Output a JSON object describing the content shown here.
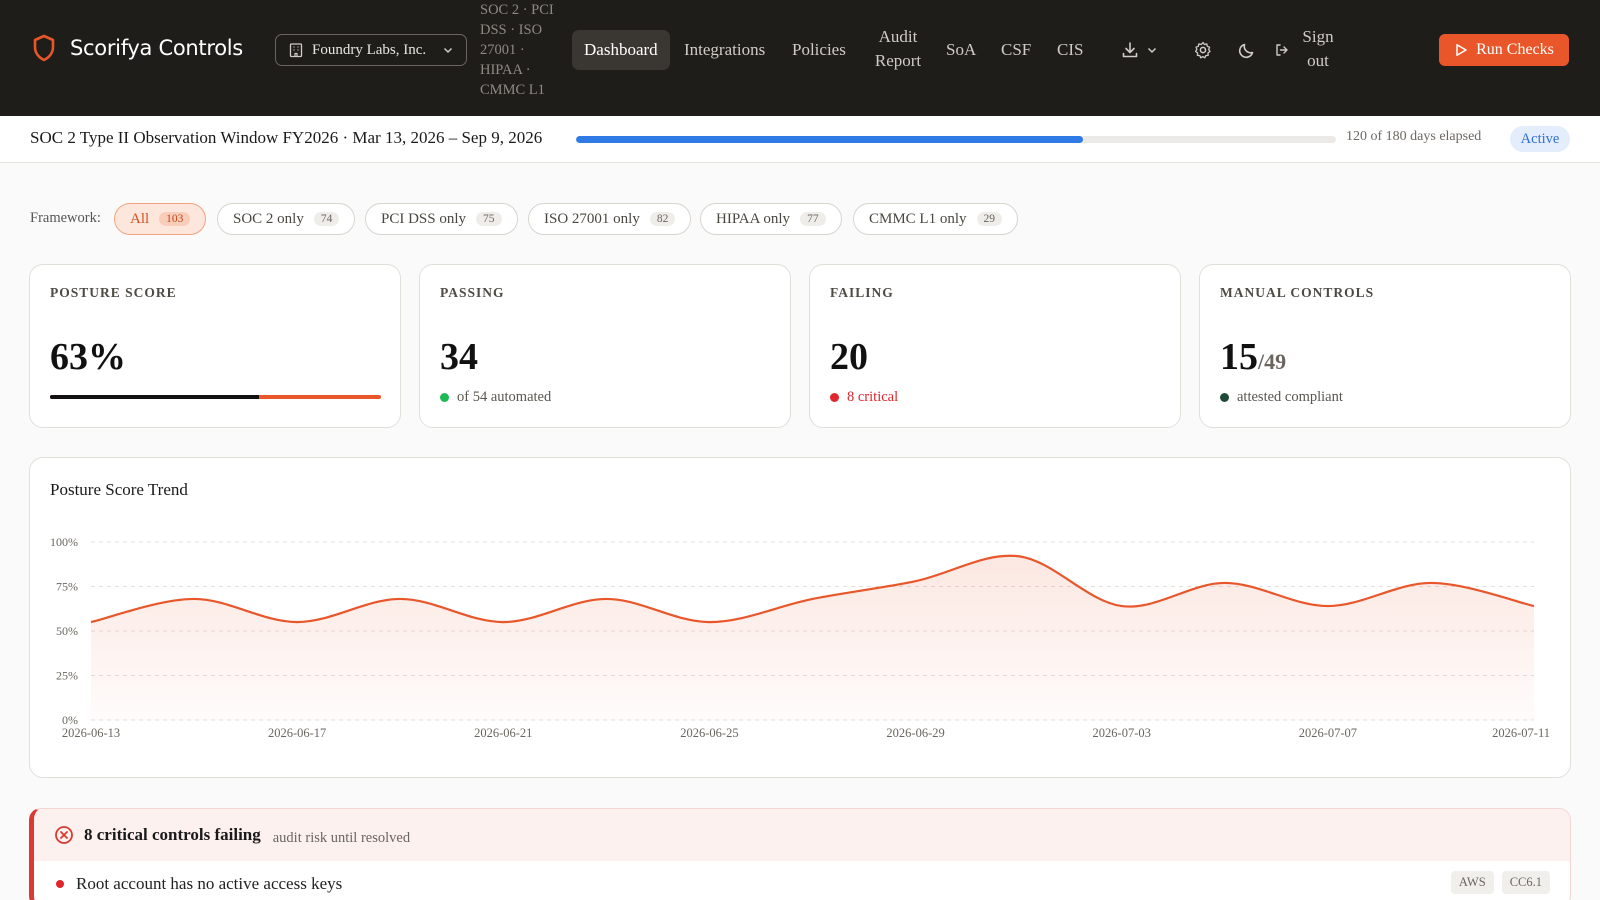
{
  "app": {
    "brand_name": "Scorifya Controls",
    "org_name": "Foundry Labs, Inc.",
    "frameworks_line": "SOC 2 · PCI DSS · ISO 27001 · HIPAA · CMMC L1"
  },
  "nav": {
    "items": [
      {
        "label": "Dashboard",
        "active": true
      },
      {
        "label": "Integrations"
      },
      {
        "label": "Policies"
      },
      {
        "label": "Audit Report"
      },
      {
        "label": "SoA"
      },
      {
        "label": "CSF"
      },
      {
        "label": "CIS"
      }
    ],
    "sign_out": "Sign out",
    "run_checks": "Run Checks",
    "icons": [
      "download-icon",
      "chevron-down-icon",
      "gear-icon",
      "moon-icon",
      "sign-out-icon",
      "play-icon"
    ]
  },
  "observation": {
    "title": "SOC 2 Type II Observation Window FY2026 · Mar 13, 2026 – Sep 9, 2026",
    "progress_fraction": 0.667,
    "days_text": "120 of 180 days elapsed",
    "status": "Active"
  },
  "filters": {
    "label": "Framework:",
    "chips": [
      {
        "label": "All",
        "count": "103",
        "active": true
      },
      {
        "label": "SOC 2 only",
        "count": "74"
      },
      {
        "label": "PCI DSS only",
        "count": "75"
      },
      {
        "label": "ISO 27001 only",
        "count": "82"
      },
      {
        "label": "HIPAA only",
        "count": "77"
      },
      {
        "label": "CMMC L1 only",
        "count": "29"
      }
    ]
  },
  "stats": {
    "posture": {
      "label": "POSTURE SCORE",
      "value": "63%",
      "fraction": 0.63
    },
    "passing": {
      "label": "PASSING",
      "value": "34",
      "note": "of 54 automated"
    },
    "failing": {
      "label": "FAILING",
      "value": "20",
      "note": "8 critical"
    },
    "manual": {
      "label": "MANUAL CONTROLS",
      "value": "15",
      "sub": "/49",
      "note": "attested compliant"
    }
  },
  "colors": {
    "accent": "#e8562a",
    "progress": "#2f7ae5",
    "pass": "#1db954",
    "fail": "#e0252b",
    "manual": "#1f4a3a"
  },
  "trend": {
    "title": "Posture Score Trend"
  },
  "chart_data": {
    "type": "area",
    "title": "Posture Score Trend",
    "x": [
      "2026-06-13",
      "2026-06-15",
      "2026-06-17",
      "2026-06-19",
      "2026-06-21",
      "2026-06-23",
      "2026-06-25",
      "2026-06-27",
      "2026-06-29",
      "2026-07-01",
      "2026-07-03",
      "2026-07-05",
      "2026-07-07",
      "2026-07-09",
      "2026-07-11"
    ],
    "values": [
      55,
      68,
      55,
      68,
      55,
      68,
      55,
      68,
      78,
      92,
      64,
      77,
      64,
      77,
      64
    ],
    "xticks": [
      "2026-06-13",
      "2026-06-17",
      "2026-06-21",
      "2026-06-25",
      "2026-06-29",
      "2026-07-03",
      "2026-07-07",
      "2026-07-11"
    ],
    "yticks": [
      "0%",
      "25%",
      "50%",
      "75%",
      "100%"
    ],
    "ylim": [
      0,
      100
    ],
    "grid": true,
    "color": "#e8562a"
  },
  "alert": {
    "title": "8 critical controls failing",
    "sub": "audit risk until resolved",
    "rows": [
      {
        "text": "Root account has no active access keys",
        "tags": [
          "AWS",
          "CC6.1"
        ]
      }
    ]
  }
}
